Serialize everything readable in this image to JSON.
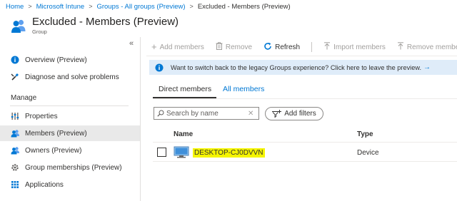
{
  "breadcrumb": {
    "items": [
      "Home",
      "Microsoft Intune",
      "Groups - All groups (Preview)"
    ],
    "current": "Excluded - Members (Preview)"
  },
  "header": {
    "title": "Excluded - Members (Preview)",
    "subtitle": "Group"
  },
  "sidebar": {
    "collapse_glyph": "«",
    "items_top": [
      {
        "label": "Overview (Preview)",
        "icon": "info-icon"
      },
      {
        "label": "Diagnose and solve problems",
        "icon": "wrench-icon"
      }
    ],
    "section_label": "Manage",
    "items_manage": [
      {
        "label": "Properties",
        "icon": "properties-icon"
      },
      {
        "label": "Members (Preview)",
        "icon": "members-icon",
        "active": true
      },
      {
        "label": "Owners (Preview)",
        "icon": "owners-icon"
      },
      {
        "label": "Group memberships (Preview)",
        "icon": "gear-icon"
      },
      {
        "label": "Applications",
        "icon": "applications-icon"
      }
    ]
  },
  "toolbar": {
    "add_label": "Add members",
    "remove_label": "Remove",
    "refresh_label": "Refresh",
    "import_label": "Import members",
    "remove_members_label": "Remove member"
  },
  "banner": {
    "text": "Want to switch back to the legacy Groups experience? Click here to leave the preview.",
    "arrow": "→"
  },
  "tabs": [
    {
      "label": "Direct members",
      "active": true
    },
    {
      "label": "All members",
      "active": false
    }
  ],
  "search": {
    "placeholder": "Search by name",
    "value": ""
  },
  "filter": {
    "label": "Add filters"
  },
  "table": {
    "columns": [
      "Name",
      "Type"
    ],
    "rows": [
      {
        "name": "DESKTOP-CJ0DVVN",
        "type": "Device",
        "highlight": "#f5f500"
      }
    ]
  },
  "colors": {
    "accent": "#0078d4",
    "banner_bg": "#dfecf9",
    "active_nav_bg": "#e9e9e9"
  }
}
